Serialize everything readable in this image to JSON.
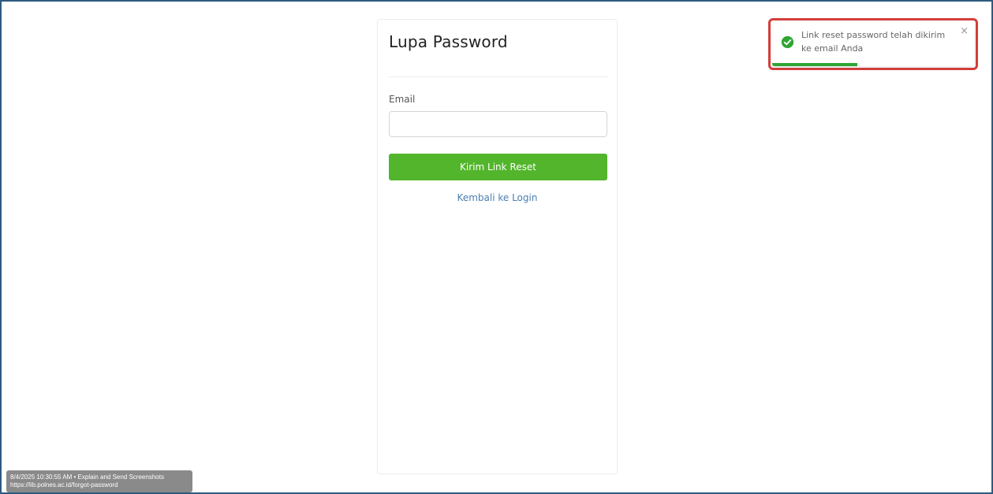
{
  "card": {
    "title": "Lupa Password",
    "email_label": "Email",
    "email_value": "",
    "email_placeholder": "",
    "submit_label": "Kirim Link Reset",
    "back_link_label": "Kembali ke Login"
  },
  "toast": {
    "message": "Link reset password telah dikirim ke email Anda",
    "close_glyph": "×",
    "status": "success",
    "progress_fraction": 0.42,
    "icon": "check-circle-icon",
    "colors": {
      "success": "#2fa533",
      "highlight_border": "#d43f3a"
    }
  },
  "overlay": {
    "line1": "8/4/2025 10:30:55 AM • Explain and Send Screenshots",
    "line2": "https://lib.polnes.ac.id/forgot-password"
  },
  "colors": {
    "primary_button": "#52b52b",
    "link": "#4a7fb0",
    "frame_border": "#2d5a80"
  }
}
